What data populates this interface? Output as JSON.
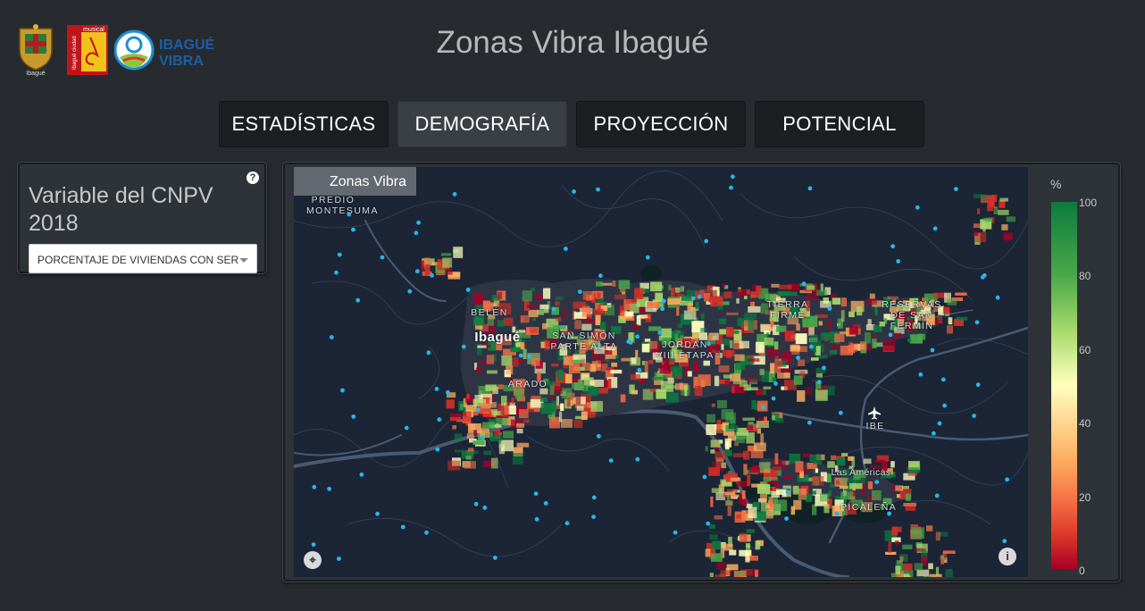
{
  "header": {
    "title": "Zonas Vibra Ibagué",
    "logos": {
      "crest_caption": "Ibagué",
      "musical_word": "musical",
      "musical_side": "Ibagué ciudad",
      "vibra_line1": "IBAGUÉ",
      "vibra_line2": "VIBRA"
    }
  },
  "tabs": [
    {
      "label": "ESTADÍSTICAS",
      "active": false
    },
    {
      "label": "DEMOGRAFÍA",
      "active": true
    },
    {
      "label": "PROYECCIÓN",
      "active": false
    },
    {
      "label": "POTENCIAL",
      "active": false
    }
  ],
  "sidebar": {
    "title": "Variable del CNPV 2018",
    "help_icon": "question-circle-icon",
    "select_value": "PORCENTAJE DE VIVIENDAS CON SER"
  },
  "map": {
    "layer_label": "Zonas Vibra",
    "places": [
      "PREDIO MONTESUMA",
      "BELÉN",
      "Ibagué",
      "SAN SIMÓN PARTE ALTA",
      "JORDÁN VIII ETAPA",
      "TIERRA FIRME",
      "RESERVAS DE SAN FERMÍN",
      "ARADO",
      "IBE",
      "Las Américas",
      "PICALEÑA"
    ],
    "airport_icon": "airplane-icon",
    "locate_icon": "locate-icon",
    "info_icon": "info-icon"
  },
  "legend": {
    "unit": "%",
    "ticks": [
      "100",
      "80",
      "60",
      "40",
      "20",
      "0"
    ],
    "colors": [
      "#0b7c3f",
      "#4aa84a",
      "#a6d96a",
      "#ffffbf",
      "#fdae61",
      "#f46d43",
      "#d73027",
      "#a50026"
    ]
  }
}
